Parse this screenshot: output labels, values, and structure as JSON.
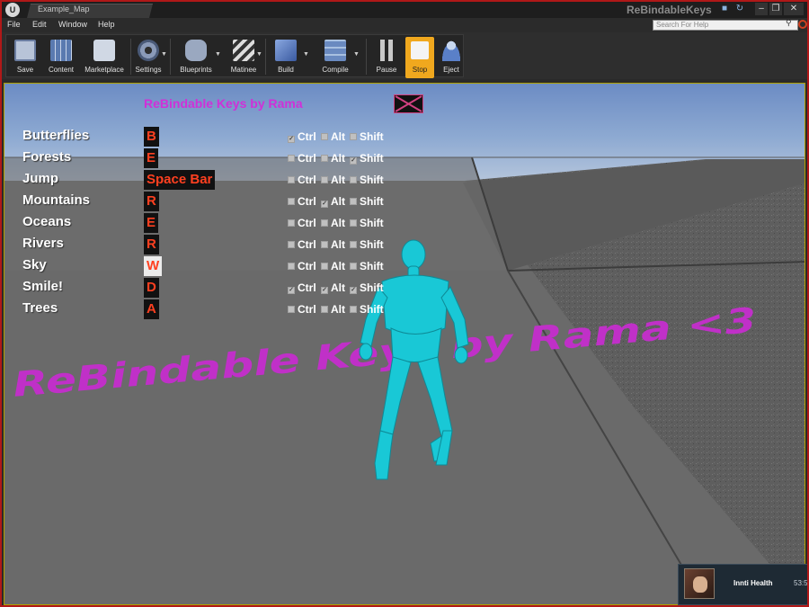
{
  "window": {
    "tab_title": "Example_Map",
    "app_title": "ReBindableKeys"
  },
  "menu": {
    "items": [
      "File",
      "Edit",
      "Window",
      "Help"
    ],
    "help_search_placeholder": "Search For Help"
  },
  "toolbar": {
    "save": "Save",
    "content": "Content",
    "marketplace": "Marketplace",
    "settings": "Settings",
    "blueprints": "Blueprints",
    "matinee": "Matinee",
    "build": "Build",
    "compile": "Compile",
    "pause": "Pause",
    "stop": "Stop",
    "eject": "Eject"
  },
  "game_menu": {
    "title": "ReBindable Keys by Rama",
    "modifier_labels": {
      "ctrl": "Ctrl",
      "alt": "Alt",
      "shift": "Shift"
    },
    "rows": [
      {
        "action": "Butterflies",
        "key": "B",
        "ctrl": true,
        "alt": false,
        "shift": false
      },
      {
        "action": "Forests",
        "key": "E",
        "ctrl": false,
        "alt": false,
        "shift": true
      },
      {
        "action": "Jump",
        "key": "Space Bar",
        "ctrl": false,
        "alt": false,
        "shift": false
      },
      {
        "action": "Mountains",
        "key": "R",
        "ctrl": false,
        "alt": true,
        "shift": false
      },
      {
        "action": "Oceans",
        "key": "E",
        "ctrl": false,
        "alt": false,
        "shift": false
      },
      {
        "action": "Rivers",
        "key": "R",
        "ctrl": false,
        "alt": false,
        "shift": false
      },
      {
        "action": "Sky",
        "key": "W",
        "ctrl": false,
        "alt": false,
        "shift": false,
        "highlighted": true
      },
      {
        "action": "Smile!",
        "key": "D",
        "ctrl": true,
        "alt": true,
        "shift": true
      },
      {
        "action": "Trees",
        "key": "A",
        "ctrl": false,
        "alt": false,
        "shift": false
      }
    ]
  },
  "scene": {
    "floor_text": "ReBindable Keys by Rama <3",
    "character_color": "#19c8d6",
    "floor_text_color": "#c030c8"
  },
  "notification": {
    "title": "Innti Health",
    "time": "53:5"
  },
  "colors": {
    "window_border": "#b01818",
    "stop_button": "#f0a81e",
    "key_text": "#ff4020",
    "menu_title": "#d030d8"
  }
}
